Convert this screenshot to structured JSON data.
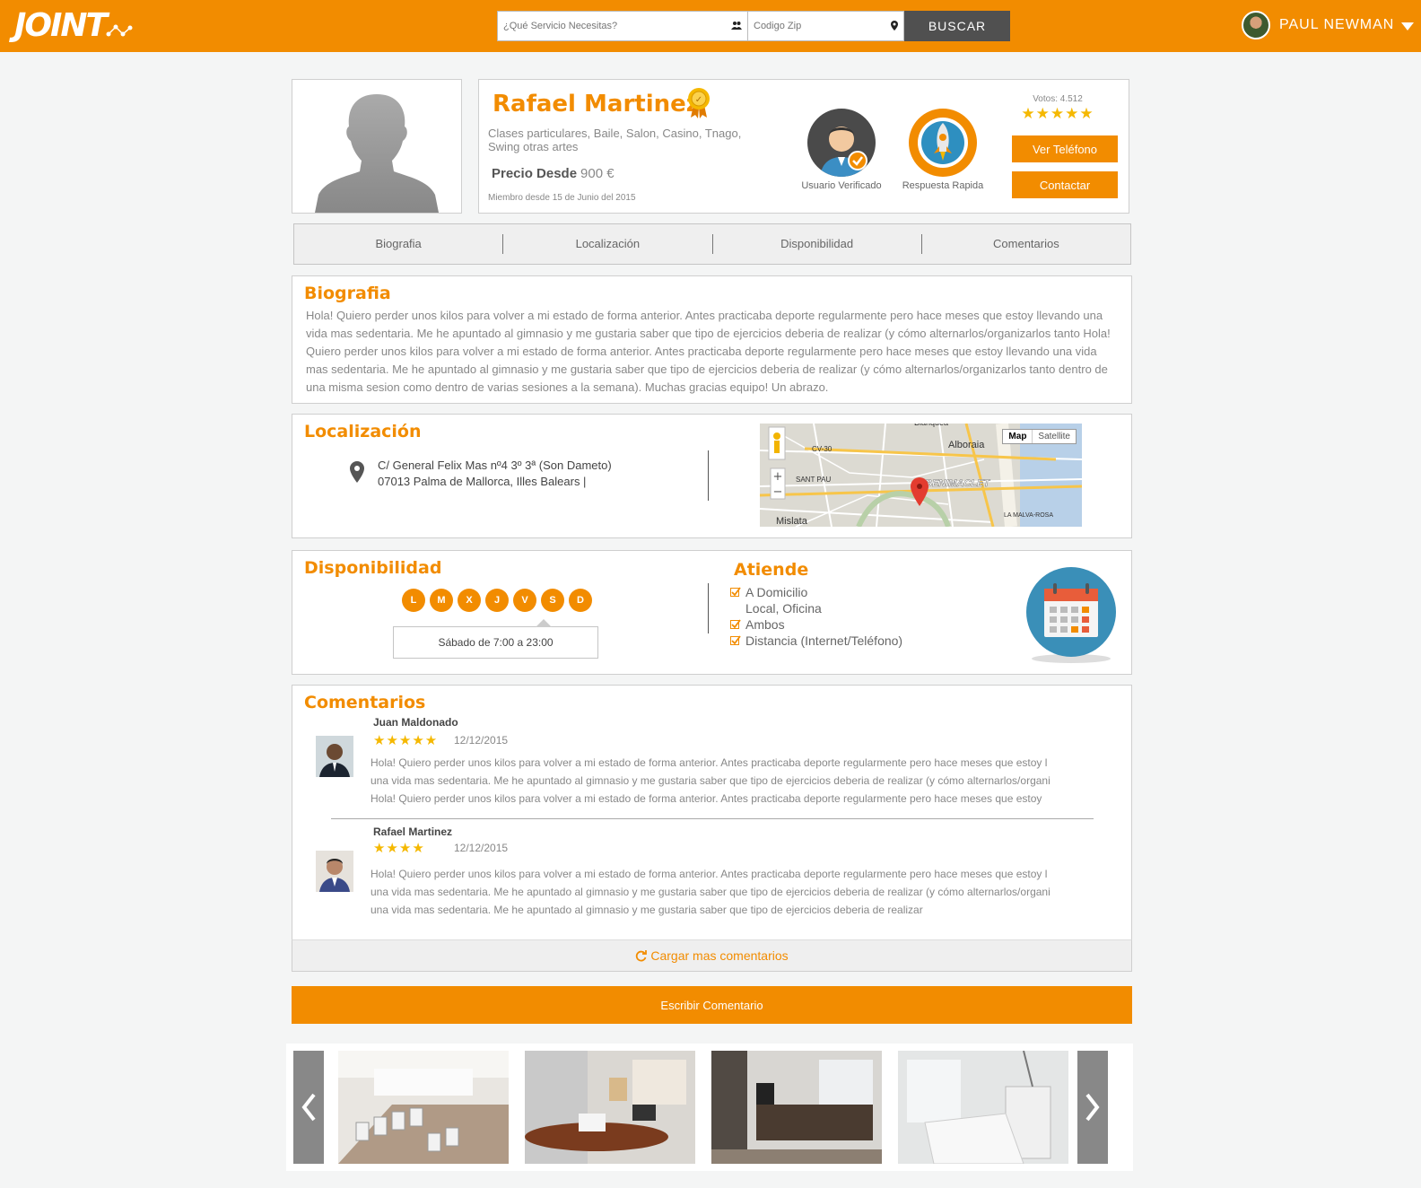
{
  "header": {
    "logo_text": "JOINT",
    "search_placeholder": "¿Qué Servicio Necesitas?",
    "zip_placeholder": "Codigo Zip",
    "search_button": "BUSCAR",
    "user_name": "PAUL NEWMAN"
  },
  "profile": {
    "name": "Rafael Martinez",
    "tags": "Clases particulares, Baile, Salon, Casino, Tnago, Swing otras artes",
    "price_label": "Precio Desde",
    "price_value": "900 €",
    "member_since": "Miembro desde 15 de Junio del 2015",
    "badge_verified": "Usuario Verificado",
    "badge_fast": "Respuesta Rapida",
    "votes": "Votos: 4.512",
    "rating_stars": 5,
    "phone_button": "Ver Teléfono",
    "contact_button": "Contactar"
  },
  "tabs": [
    "Biografia",
    "Localización",
    "Disponibilidad",
    "Comentarios"
  ],
  "bio": {
    "title": "Biografia",
    "text": "Hola! Quiero perder unos kilos para volver a mi estado de forma anterior. Antes practicaba deporte regularmente pero hace meses que estoy llevando una vida mas sedentaria. Me he apuntado al gimnasio y me gustaria saber que tipo de ejercicios deberia de realizar (y cómo alternarlos/organizarlos tanto Hola! Quiero perder unos kilos para volver a mi estado de forma anterior. Antes practicaba deporte regularmente pero hace meses que estoy llevando una vida mas sedentaria. Me he apuntado al gimnasio y me gustaria saber que tipo de ejercicios deberia de realizar (y cómo alternarlos/organizarlos tanto dentro de una misma sesion como dentro de varias sesiones a la semana). Muchas gracias equipo! Un abrazo."
  },
  "location": {
    "title": "Localización",
    "address_line1": "C/ General Felix Mas nº4 3º 3ª (Son Dameto)",
    "address_line2": "07013 Palma de Mallorca, Illes Balears |",
    "map_btn_map": "Map",
    "map_btn_satellite": "Satellite",
    "map_labels": [
      "Alboraia",
      "CV-30",
      "SANT PAU",
      "BENIMACLET",
      "Mislata",
      "LA MALVA-ROSA",
      "Blanquea"
    ]
  },
  "availability": {
    "title": "Disponibilidad",
    "days": [
      "L",
      "M",
      "X",
      "J",
      "V",
      "S",
      "D"
    ],
    "schedule": "Sábado de 7:00 a 23:00",
    "attends_title": "Atiende",
    "attends": [
      {
        "label": "A Domicilio",
        "checked": true
      },
      {
        "label": "Local, Oficina",
        "checked": false
      },
      {
        "label": "Ambos",
        "checked": true
      },
      {
        "label": "Distancia (Internet/Teléfono)",
        "checked": true
      }
    ]
  },
  "comments": {
    "title": "Comentarios",
    "items": [
      {
        "author": "Juan Maldonado",
        "stars": "★★★★★",
        "rating": 5,
        "date": "12/12/2015",
        "lines": [
          "Hola! Quiero perder unos kilos para volver a mi estado de forma anterior. Antes practicaba deporte regularmente pero hace meses que estoy l",
          "una vida mas sedentaria. Me he apuntado al gimnasio y me gustaria saber que tipo de ejercicios deberia de realizar (y cómo alternarlos/organi",
          "Hola! Quiero perder unos kilos para volver a mi estado de forma anterior. Antes practicaba deporte regularmente pero hace meses que estoy"
        ]
      },
      {
        "author": "Rafael Martinez",
        "stars": "★★★★",
        "rating": 4,
        "date": "12/12/2015",
        "lines": [
          "Hola! Quiero perder unos kilos para volver a mi estado de forma anterior. Antes practicaba deporte regularmente pero hace meses que estoy l",
          "una vida mas sedentaria. Me he apuntado al gimnasio y me gustaria saber que tipo de ejercicios deberia de realizar (y cómo alternarlos/organi",
          "una vida mas sedentaria. Me he apuntado al gimnasio y me gustaria saber que tipo de ejercicios deberia de realizar"
        ]
      }
    ],
    "load_more": "Cargar mas comentarios",
    "write_button": "Escribir Comentario"
  },
  "gallery": {
    "prev": "‹",
    "next": "›",
    "images": [
      "waiting-room",
      "office-desk",
      "office-room",
      "treatment-room"
    ]
  },
  "colors": {
    "accent": "#f28c00",
    "search_button": "#505050",
    "stars": "#f5b800"
  }
}
